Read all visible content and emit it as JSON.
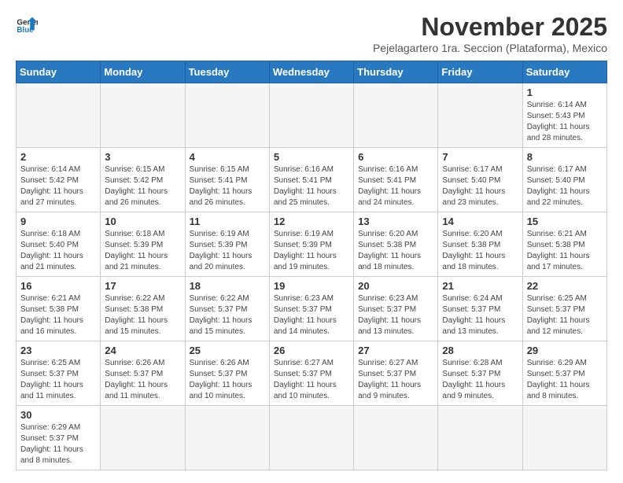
{
  "header": {
    "logo_general": "General",
    "logo_blue": "Blue",
    "title": "November 2025",
    "subtitle": "Pejelagartero 1ra. Seccion (Plataforma), Mexico"
  },
  "weekdays": [
    "Sunday",
    "Monday",
    "Tuesday",
    "Wednesday",
    "Thursday",
    "Friday",
    "Saturday"
  ],
  "weeks": [
    [
      {
        "day": "",
        "info": ""
      },
      {
        "day": "",
        "info": ""
      },
      {
        "day": "",
        "info": ""
      },
      {
        "day": "",
        "info": ""
      },
      {
        "day": "",
        "info": ""
      },
      {
        "day": "",
        "info": ""
      },
      {
        "day": "1",
        "info": "Sunrise: 6:14 AM\nSunset: 5:43 PM\nDaylight: 11 hours\nand 28 minutes."
      }
    ],
    [
      {
        "day": "2",
        "info": "Sunrise: 6:14 AM\nSunset: 5:42 PM\nDaylight: 11 hours\nand 27 minutes."
      },
      {
        "day": "3",
        "info": "Sunrise: 6:15 AM\nSunset: 5:42 PM\nDaylight: 11 hours\nand 26 minutes."
      },
      {
        "day": "4",
        "info": "Sunrise: 6:15 AM\nSunset: 5:41 PM\nDaylight: 11 hours\nand 26 minutes."
      },
      {
        "day": "5",
        "info": "Sunrise: 6:16 AM\nSunset: 5:41 PM\nDaylight: 11 hours\nand 25 minutes."
      },
      {
        "day": "6",
        "info": "Sunrise: 6:16 AM\nSunset: 5:41 PM\nDaylight: 11 hours\nand 24 minutes."
      },
      {
        "day": "7",
        "info": "Sunrise: 6:17 AM\nSunset: 5:40 PM\nDaylight: 11 hours\nand 23 minutes."
      },
      {
        "day": "8",
        "info": "Sunrise: 6:17 AM\nSunset: 5:40 PM\nDaylight: 11 hours\nand 22 minutes."
      }
    ],
    [
      {
        "day": "9",
        "info": "Sunrise: 6:18 AM\nSunset: 5:40 PM\nDaylight: 11 hours\nand 21 minutes."
      },
      {
        "day": "10",
        "info": "Sunrise: 6:18 AM\nSunset: 5:39 PM\nDaylight: 11 hours\nand 21 minutes."
      },
      {
        "day": "11",
        "info": "Sunrise: 6:19 AM\nSunset: 5:39 PM\nDaylight: 11 hours\nand 20 minutes."
      },
      {
        "day": "12",
        "info": "Sunrise: 6:19 AM\nSunset: 5:39 PM\nDaylight: 11 hours\nand 19 minutes."
      },
      {
        "day": "13",
        "info": "Sunrise: 6:20 AM\nSunset: 5:38 PM\nDaylight: 11 hours\nand 18 minutes."
      },
      {
        "day": "14",
        "info": "Sunrise: 6:20 AM\nSunset: 5:38 PM\nDaylight: 11 hours\nand 18 minutes."
      },
      {
        "day": "15",
        "info": "Sunrise: 6:21 AM\nSunset: 5:38 PM\nDaylight: 11 hours\nand 17 minutes."
      }
    ],
    [
      {
        "day": "16",
        "info": "Sunrise: 6:21 AM\nSunset: 5:38 PM\nDaylight: 11 hours\nand 16 minutes."
      },
      {
        "day": "17",
        "info": "Sunrise: 6:22 AM\nSunset: 5:38 PM\nDaylight: 11 hours\nand 15 minutes."
      },
      {
        "day": "18",
        "info": "Sunrise: 6:22 AM\nSunset: 5:37 PM\nDaylight: 11 hours\nand 15 minutes."
      },
      {
        "day": "19",
        "info": "Sunrise: 6:23 AM\nSunset: 5:37 PM\nDaylight: 11 hours\nand 14 minutes."
      },
      {
        "day": "20",
        "info": "Sunrise: 6:23 AM\nSunset: 5:37 PM\nDaylight: 11 hours\nand 13 minutes."
      },
      {
        "day": "21",
        "info": "Sunrise: 6:24 AM\nSunset: 5:37 PM\nDaylight: 11 hours\nand 13 minutes."
      },
      {
        "day": "22",
        "info": "Sunrise: 6:25 AM\nSunset: 5:37 PM\nDaylight: 11 hours\nand 12 minutes."
      }
    ],
    [
      {
        "day": "23",
        "info": "Sunrise: 6:25 AM\nSunset: 5:37 PM\nDaylight: 11 hours\nand 11 minutes."
      },
      {
        "day": "24",
        "info": "Sunrise: 6:26 AM\nSunset: 5:37 PM\nDaylight: 11 hours\nand 11 minutes."
      },
      {
        "day": "25",
        "info": "Sunrise: 6:26 AM\nSunset: 5:37 PM\nDaylight: 11 hours\nand 10 minutes."
      },
      {
        "day": "26",
        "info": "Sunrise: 6:27 AM\nSunset: 5:37 PM\nDaylight: 11 hours\nand 10 minutes."
      },
      {
        "day": "27",
        "info": "Sunrise: 6:27 AM\nSunset: 5:37 PM\nDaylight: 11 hours\nand 9 minutes."
      },
      {
        "day": "28",
        "info": "Sunrise: 6:28 AM\nSunset: 5:37 PM\nDaylight: 11 hours\nand 9 minutes."
      },
      {
        "day": "29",
        "info": "Sunrise: 6:29 AM\nSunset: 5:37 PM\nDaylight: 11 hours\nand 8 minutes."
      }
    ],
    [
      {
        "day": "30",
        "info": "Sunrise: 6:29 AM\nSunset: 5:37 PM\nDaylight: 11 hours\nand 8 minutes."
      },
      {
        "day": "",
        "info": ""
      },
      {
        "day": "",
        "info": ""
      },
      {
        "day": "",
        "info": ""
      },
      {
        "day": "",
        "info": ""
      },
      {
        "day": "",
        "info": ""
      },
      {
        "day": "",
        "info": ""
      }
    ]
  ]
}
